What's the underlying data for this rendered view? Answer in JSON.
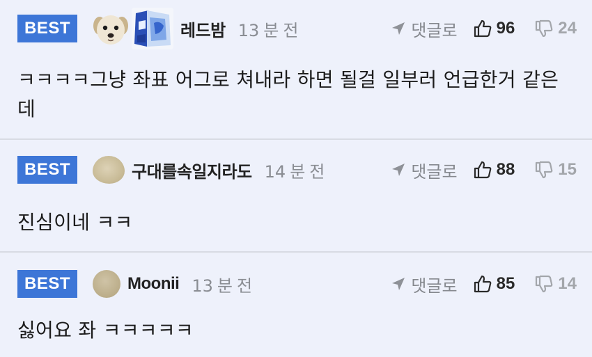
{
  "comments": [
    {
      "badge": "BEST",
      "avatar": "dog-face-avatar",
      "nickname": "레드밤",
      "time_num": "13",
      "time_unit": "분",
      "time_suffix": "전",
      "reply_label": "댓글로",
      "upvotes": "96",
      "downvotes": "24",
      "text": "ㅋㅋㅋㅋ그냥 좌표 어그로 쳐내라 하면 될걸 일부러 언급한거 같은데"
    },
    {
      "badge": "BEST",
      "avatar": "blob-avatar",
      "nickname": "구대를속일지라도",
      "time_num": "14",
      "time_unit": "분",
      "time_suffix": "전",
      "reply_label": "댓글로",
      "upvotes": "88",
      "downvotes": "15",
      "text": "진심이네 ㅋㅋ"
    },
    {
      "badge": "BEST",
      "avatar": "default-avatar",
      "nickname": "Moonii",
      "time_num": "13",
      "time_unit": "분",
      "time_suffix": "전",
      "reply_label": "댓글로",
      "upvotes": "85",
      "downvotes": "14",
      "text": "싫어요 좌 ㅋㅋㅋㅋㅋ"
    }
  ],
  "colors": {
    "background": "#eef1fb",
    "best_badge": "#3d76d7",
    "divider": "#d8dbe3",
    "muted_text": "#8a8d93"
  },
  "icons": {
    "reply": "arrow-send-icon",
    "upvote": "thumbs-up-icon",
    "downvote": "thumbs-down-icon"
  }
}
